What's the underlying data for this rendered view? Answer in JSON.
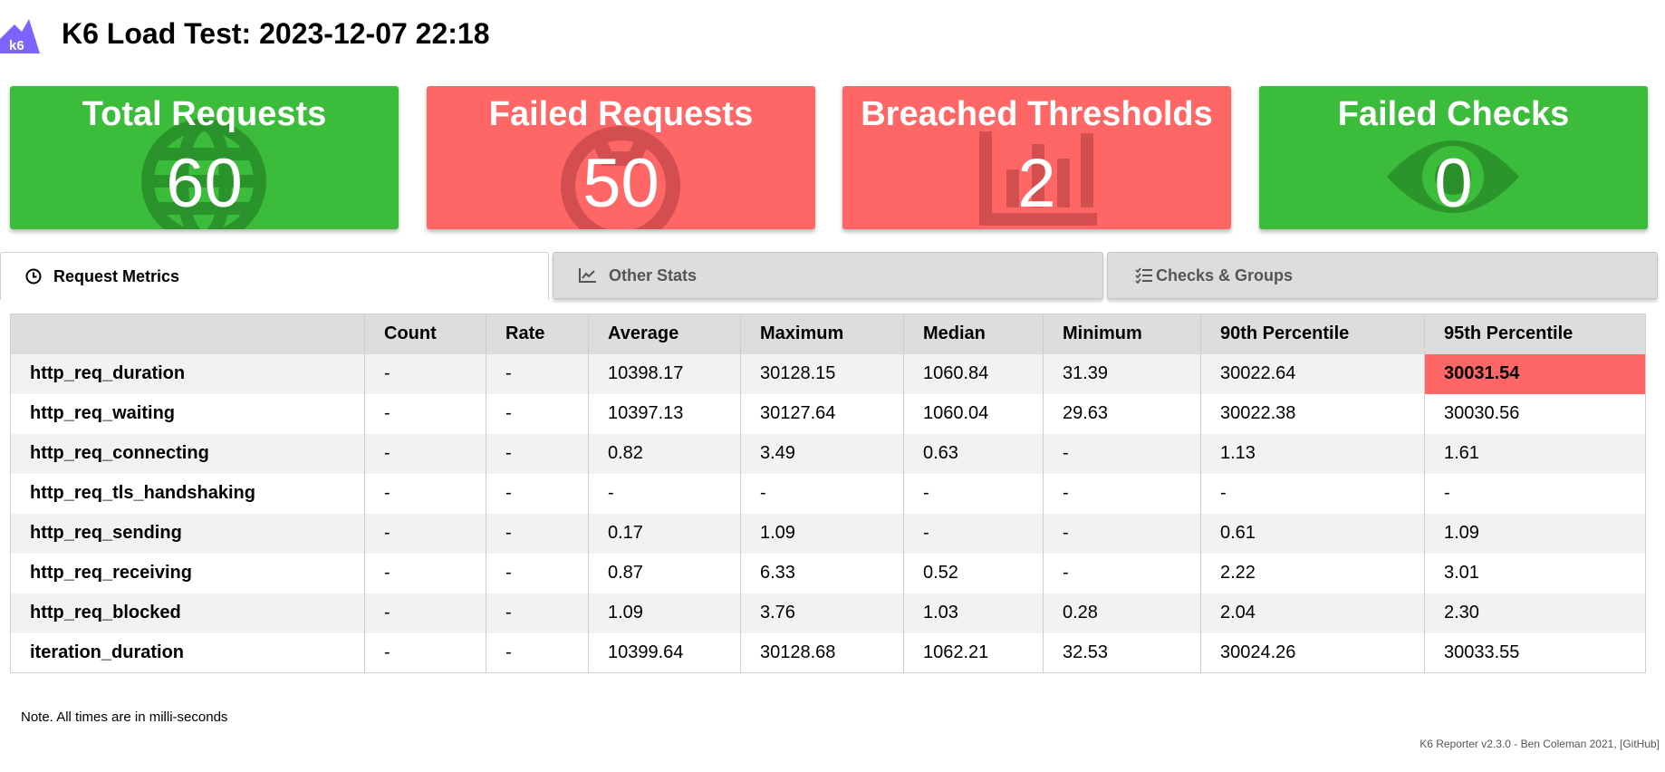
{
  "header": {
    "logo_text": "k6",
    "title": "K6 Load Test: 2023-12-07 22:18"
  },
  "cards": [
    {
      "label": "Total Requests",
      "value": "60",
      "status": "good",
      "icon": "globe-icon"
    },
    {
      "label": "Failed Requests",
      "value": "50",
      "status": "bad",
      "icon": "bug-icon"
    },
    {
      "label": "Breached Thresholds",
      "value": "2",
      "status": "bad",
      "icon": "chart-icon"
    },
    {
      "label": "Failed Checks",
      "value": "0",
      "status": "good",
      "icon": "eye-icon"
    }
  ],
  "colors": {
    "good": "#3bbd3b",
    "bad": "#ff6666",
    "header_bg": "#dddddd",
    "odd_row": "#f2f2f2"
  },
  "tabs": [
    {
      "label": "Request Metrics",
      "icon": "clock-icon",
      "active": true
    },
    {
      "label": "Other Stats",
      "icon": "line-chart-icon",
      "active": false
    },
    {
      "label": "Checks & Groups",
      "icon": "checklist-icon",
      "active": false
    }
  ],
  "table": {
    "columns": [
      "",
      "Count",
      "Rate",
      "Average",
      "Maximum",
      "Median",
      "Minimum",
      "90th Percentile",
      "95th Percentile"
    ],
    "rows": [
      [
        "http_req_duration",
        "-",
        "-",
        "10398.17",
        "30128.15",
        "1060.84",
        "31.39",
        "30022.64",
        "30031.54"
      ],
      [
        "http_req_waiting",
        "-",
        "-",
        "10397.13",
        "30127.64",
        "1060.04",
        "29.63",
        "30022.38",
        "30030.56"
      ],
      [
        "http_req_connecting",
        "-",
        "-",
        "0.82",
        "3.49",
        "0.63",
        "-",
        "1.13",
        "1.61"
      ],
      [
        "http_req_tls_handshaking",
        "-",
        "-",
        "-",
        "-",
        "-",
        "-",
        "-",
        "-"
      ],
      [
        "http_req_sending",
        "-",
        "-",
        "0.17",
        "1.09",
        "-",
        "-",
        "0.61",
        "1.09"
      ],
      [
        "http_req_receiving",
        "-",
        "-",
        "0.87",
        "6.33",
        "0.52",
        "-",
        "2.22",
        "3.01"
      ],
      [
        "http_req_blocked",
        "-",
        "-",
        "1.09",
        "3.76",
        "1.03",
        "0.28",
        "2.04",
        "2.30"
      ],
      [
        "iteration_duration",
        "-",
        "-",
        "10399.64",
        "30128.68",
        "1062.21",
        "32.53",
        "30024.26",
        "30033.55"
      ]
    ],
    "breached_cell": {
      "row": 0,
      "col": 8
    }
  },
  "note": "Note. All times are in milli-seconds",
  "footer": {
    "text": "K6 Reporter v2.3.0 - Ben Coleman 2021, ",
    "link": "[GitHub]"
  }
}
